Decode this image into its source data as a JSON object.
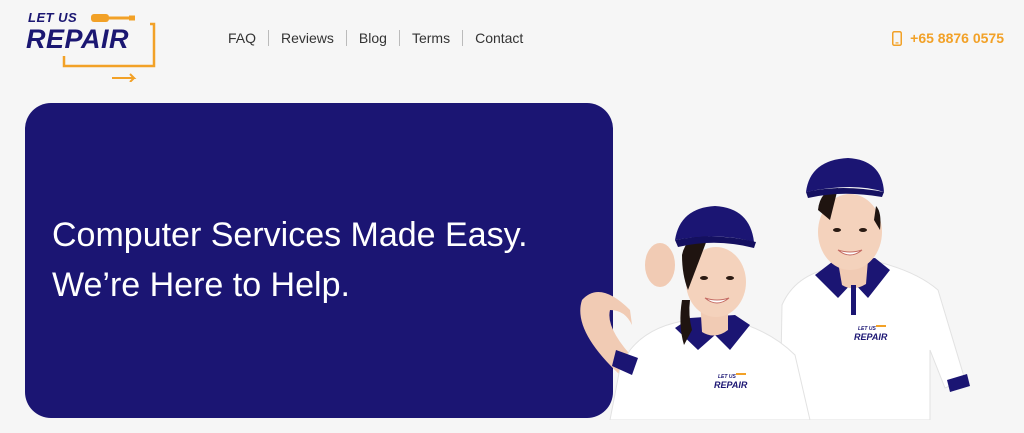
{
  "logo": {
    "line1": "LET US",
    "line2": "REPAIR",
    "colors": {
      "navy": "#1b1772",
      "orange": "#f2a127"
    }
  },
  "nav": {
    "items": [
      {
        "label": "FAQ"
      },
      {
        "label": "Reviews"
      },
      {
        "label": "Blog"
      },
      {
        "label": "Terms"
      },
      {
        "label": "Contact"
      }
    ]
  },
  "contact": {
    "phone": "+65 8876 0575",
    "icon": "phone-icon"
  },
  "hero": {
    "headline_line1": "Computer Services Made Easy.",
    "headline_line2": "We’re Here to Help.",
    "background_color": "#1b1573",
    "shirt_logo_line1": "LET US",
    "shirt_logo_line2": "REPAIR"
  }
}
